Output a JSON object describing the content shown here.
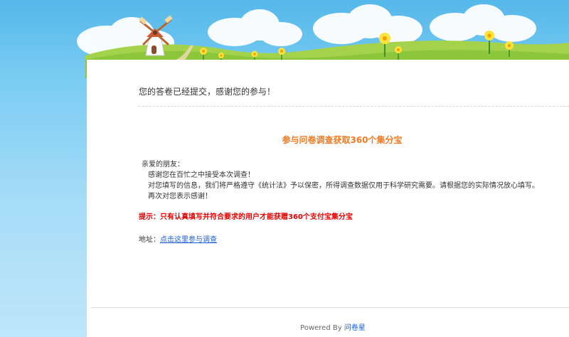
{
  "confirmation": {
    "message": "您的答卷已经提交，感谢您的参与！"
  },
  "promo": {
    "title": "参与问卷调查获取360个集分宝"
  },
  "letter": {
    "greeting": "亲爱的朋友：",
    "line1": "感谢您在百忙之中接受本次调查！",
    "line2": "对您填写的信息，我们将严格遵守《统计法》予以保密，所得调查数据仅用于科学研究需要。请根据您的实际情况放心填写。",
    "line3": "再次对您表示感谢！"
  },
  "notice": {
    "text": "提示：只有认真填写并符合要求的用户才能获赠360个支付宝集分宝"
  },
  "address": {
    "label": "地址：",
    "link_text": "点击这里参与调查"
  },
  "footer": {
    "powered_label": "Powered By",
    "brand": "问卷星"
  },
  "colors": {
    "sky": "#6cc4f0",
    "accent_orange": "#f07a22",
    "notice_red": "#e80000",
    "link_blue": "#1a5ed6"
  }
}
